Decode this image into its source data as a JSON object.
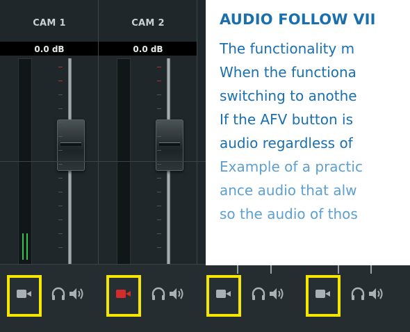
{
  "channels": [
    {
      "name": "CAM 1",
      "level": "0.0 dB",
      "afv_active": false
    },
    {
      "name": "CAM 2",
      "level": "0.0 dB",
      "afv_active": true
    }
  ],
  "info": {
    "title": "AUDIO FOLLOW VII",
    "lines": [
      "The functionality m",
      "When the functiona",
      "switching to anothe",
      "If the AFV button is",
      "audio regardless of",
      "Example of a practic",
      "ance audio that alw",
      "so the audio of thos"
    ]
  },
  "colors": {
    "highlight": "#f5e600",
    "afv_active": "#d42b2b",
    "afv_inactive": "#a9b1b4",
    "title_text": "#1a6fae",
    "body_text": "#5c9fd0",
    "meter": "#3fbf4f"
  },
  "icons": {
    "afv": "camera-icon",
    "monitor": "headphones-icon",
    "volume": "speaker-icon"
  }
}
